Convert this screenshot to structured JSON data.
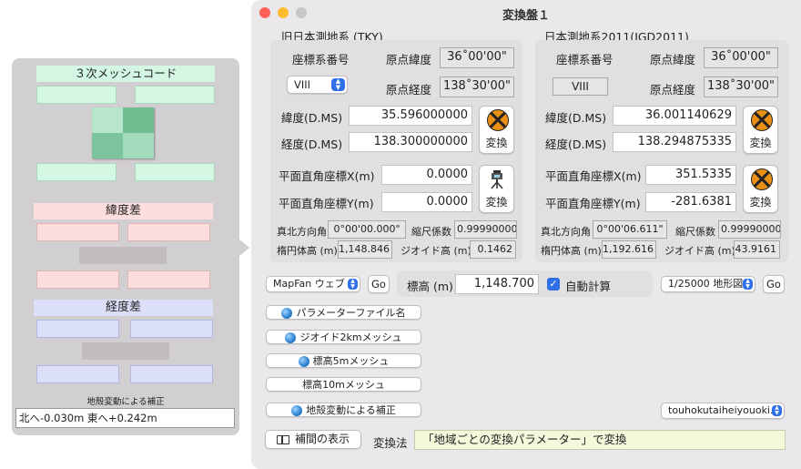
{
  "window": {
    "title": "変換盤１"
  },
  "drawer": {
    "mesh_title": "３次メッシュコード",
    "lat_diff_title": "緯度差",
    "lon_diff_title": "経度差",
    "correction_title": "地殻変動による補正",
    "correction_value": "北へ-0.030m 東へ+0.242m"
  },
  "tky": {
    "group_title": "旧日本測地系 (TKY)",
    "coord_system_label": "座標系番号",
    "coord_system_value": "VIII",
    "origin_lat_label": "原点緯度",
    "origin_lat_value": "36˚00'00\"",
    "origin_lon_label": "原点経度",
    "origin_lon_value": "138˚30'00\"",
    "lat_label": "緯度(D.MS)",
    "lat_value": "35.596000000",
    "lon_label": "経度(D.MS)",
    "lon_value": "138.300000000",
    "convert_label": "変換",
    "x_label": "平面直角座標X(m)",
    "x_value": "0.0000",
    "y_label": "平面直角座標Y(m)",
    "y_value": "0.0000",
    "convert2_label": "変換",
    "north_angle_label": "真北方向角",
    "north_angle_value": "0°00'00.000\"",
    "scale_label": "縮尺係数",
    "scale_value": "0.99990000",
    "ellipsoid_label": "楕円体高 (m)",
    "ellipsoid_value": "1,148.846",
    "geoid_label": "ジオイド高 (m)",
    "geoid_value": "0.1462"
  },
  "jgd": {
    "group_title": "日本測地系2011(JGD2011)",
    "coord_system_label": "座標系番号",
    "coord_system_value": "VIII",
    "origin_lat_label": "原点緯度",
    "origin_lat_value": "36˚00'00\"",
    "origin_lon_label": "原点経度",
    "origin_lon_value": "138˚30'00\"",
    "lat_label": "緯度(D.MS)",
    "lat_value": "36.001140629",
    "lon_label": "経度(D.MS)",
    "lon_value": "138.294875335",
    "convert_label": "変換",
    "x_label": "平面直角座標X(m)",
    "x_value": "351.5335",
    "y_label": "平面直角座標Y(m)",
    "y_value": "-281.6381",
    "convert2_label": "変換",
    "north_angle_label": "真北方向角",
    "north_angle_value": "0°00'06.611\"",
    "scale_label": "縮尺係数",
    "scale_value": "0.99990000",
    "ellipsoid_label": "楕円体高 (m)",
    "ellipsoid_value": "1,192.616",
    "geoid_label": "ジオイド高 (m)",
    "geoid_value": "43.9161"
  },
  "mapbar": {
    "map_select": "MapFan ウェブ",
    "go_label": "Go",
    "elevation_label": "標高 (m)",
    "elevation_value": "1,148.700",
    "auto_calc_label": "自動計算",
    "topo_select": "1/25000 地形図",
    "go2_label": "Go"
  },
  "files": {
    "param_file": "パラメーターファイル名",
    "geoid_mesh": "ジオイド2kmメッシュ",
    "elev5": "標高5mメッシュ",
    "elev10": "標高10mメッシュ",
    "crustal": "地殻変動による補正",
    "crustal_select": "touhokutaiheiyouoki..."
  },
  "footer": {
    "interp_button": "補間の表示",
    "method_label": "変換法",
    "method_value": "「地域ごとの変換パラメーター」で変換"
  },
  "colors": {
    "close": "#ff5f57",
    "minimize": "#febc2e",
    "zoom": "#c8c5c8",
    "accent": "#2f6fe8",
    "mesh_green": "#d4f7e4",
    "lat_red": "#fbdedd",
    "lon_blue": "#dcdff8"
  }
}
